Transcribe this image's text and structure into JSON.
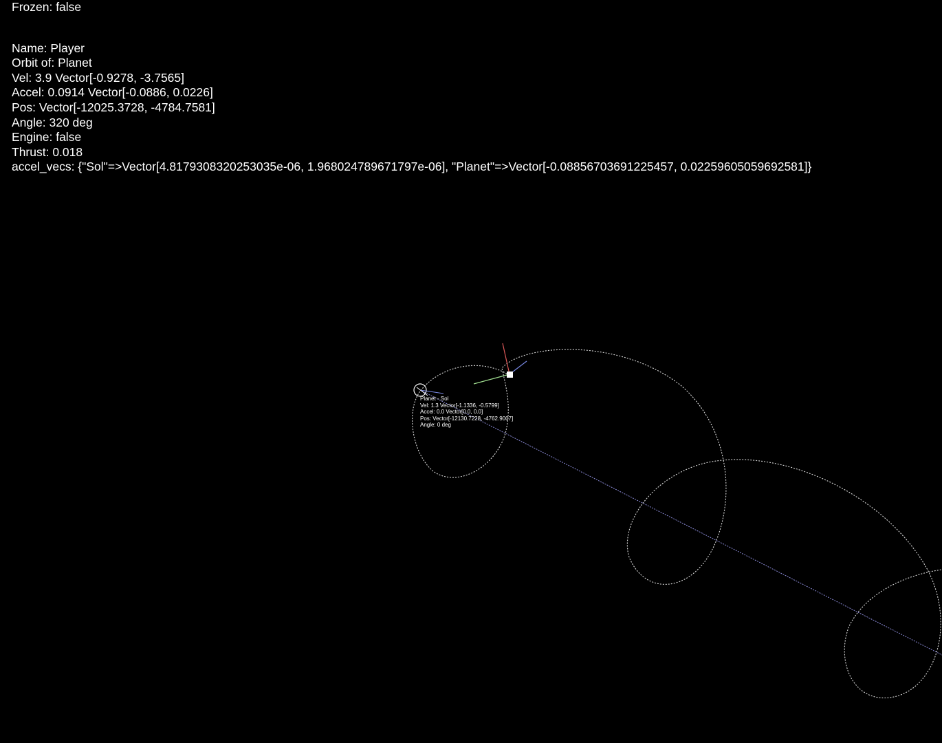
{
  "hud": {
    "frozen": "Frozen: false",
    "name": "Name: Player",
    "orbit_of": "Orbit of: Planet",
    "vel": "Vel: 3.9 Vector[-0.9278, -3.7565]",
    "accel": "Accel: 0.0914 Vector[-0.0886, 0.0226]",
    "pos": "Pos: Vector[-12025.3728, -4784.7581]",
    "angle": "Angle: 320 deg",
    "engine": "Engine: false",
    "thrust": "Thrust: 0.018",
    "accel_vecs": "accel_vecs: {\"Sol\"=>Vector[4.8179308320253035e-06, 1.968024789671797e-06], \"Planet\"=>Vector[-0.08856703691225457, 0.02259605059692581]}"
  },
  "planet_label": {
    "name": "Planet - Sol",
    "vel": "Vel: 1.3 Vector[-1.1336, -0.5799]",
    "accel": "Accel: 0.0 Vector[0.0, 0.0]",
    "pos": "Pos: Vector[-12130.7228, -4762.9007]",
    "angle": "Angle: 0 deg"
  },
  "colors": {
    "background": "#000000",
    "text": "#ffffff",
    "orbit_path": "#cfcfcf",
    "sun_line": "#8b8bd8",
    "velocity_vector": "#9fdc8f",
    "heading_vector": "#e05a5a",
    "accel_vector": "#7b8be8"
  },
  "icons": {
    "player_ship": "white-square",
    "planet": "hollow-circle"
  }
}
